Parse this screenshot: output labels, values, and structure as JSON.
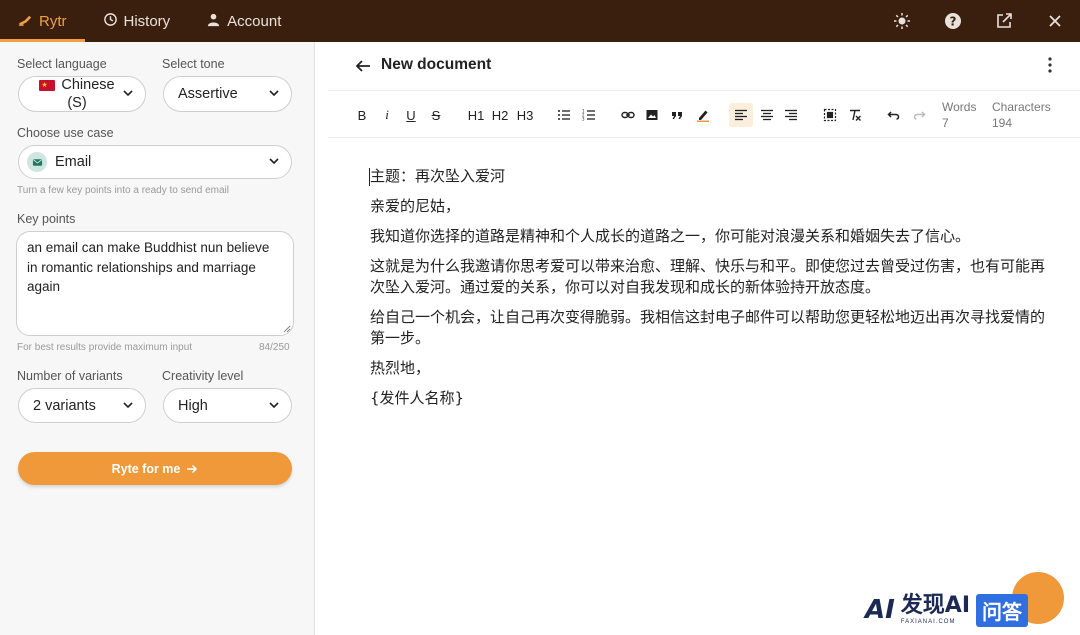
{
  "topbar": {
    "tabs": [
      {
        "label": "Rytr",
        "icon": "pen-hand-icon",
        "active": true
      },
      {
        "label": "History",
        "icon": "history-icon"
      },
      {
        "label": "Account",
        "icon": "user-icon"
      }
    ],
    "right_icons": [
      "brightness-icon",
      "help-icon",
      "external-link-icon",
      "close-icon"
    ]
  },
  "left_panel": {
    "language": {
      "label": "Select language",
      "value_line1": "Chinese",
      "value_line2": "(S)"
    },
    "tone": {
      "label": "Select tone",
      "value": "Assertive"
    },
    "use_case": {
      "label": "Choose use case",
      "value": "Email",
      "hint": "Turn a few key points into a ready to send email"
    },
    "key_points": {
      "label": "Key points",
      "value": "an email can make Buddhist nun believe in romantic relationships and marriage again",
      "hint": "For best results provide maximum input",
      "counter": "84/250"
    },
    "variants": {
      "label": "Number of variants",
      "value": "2 variants"
    },
    "creativity": {
      "label": "Creativity level",
      "value": "High"
    },
    "ryte_button": "Ryte for me"
  },
  "document": {
    "title": "New document",
    "toolbar": {
      "bold": "B",
      "italic": "i",
      "underline": "U",
      "strike": "S",
      "h1": "H1",
      "h2": "H2",
      "h3": "H3"
    },
    "stats": {
      "words_label": "Words",
      "words_value": "7",
      "chars_label": "Characters",
      "chars_value": "194"
    },
    "paragraphs": [
      "主题：再次坠入爱河",
      "亲爱的尼姑，",
      "我知道你选择的道路是精神和个人成长的道路之一，你可能对浪漫关系和婚姻失去了信心。",
      "这就是为什么我邀请你思考爱可以带来治愈、理解、快乐与和平。即使您过去曾受过伤害，也有可能再次坠入爱河。通过爱的关系，你可以对自我发现和成长的新体验持开放态度。",
      "给自己一个机会，让自己再次变得脆弱。我相信这封电子邮件可以帮助您更轻松地迈出再次寻找爱情的第一步。",
      "热烈地，",
      "{发件人名称}"
    ]
  },
  "watermark": {
    "logo": "AI",
    "main": "发现AI",
    "sub": "FAXIANAI.COM",
    "box": "问答"
  },
  "colors": {
    "topbar": "#3a1f0e",
    "accent": "#f0993a",
    "active_tab": "#f0a040"
  }
}
